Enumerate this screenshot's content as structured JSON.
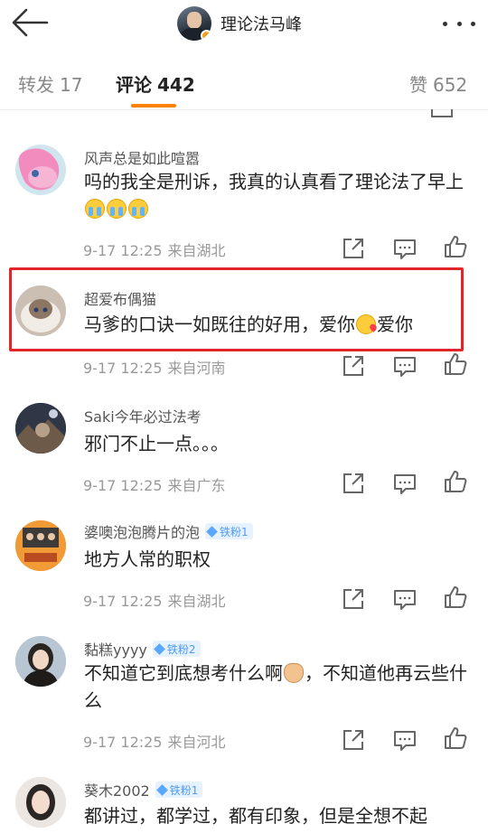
{
  "header": {
    "title": "理论法马峰"
  },
  "tabs": [
    {
      "label": "转发",
      "count": "17"
    },
    {
      "label": "评论",
      "count": "442"
    },
    {
      "label": "赞",
      "count": "652"
    }
  ],
  "comments": [
    {
      "name": "风声总是如此喧嚣",
      "text": "吗的我全是刑诉，我真的认真看了理论法了早上",
      "emojis": [
        "crying",
        "crying",
        "crying"
      ],
      "time": "9-17 12:25",
      "location": "来自湖北"
    },
    {
      "name": "超爱布偶猫",
      "text_before": "马爹的口诀一如既往的好用，爱你",
      "text_after": "爱你",
      "emoji": "kiss",
      "time": "9-17 12:25",
      "location": "来自河南"
    },
    {
      "name": "Saki今年必过法考",
      "text": "邪门不止一点。。。",
      "time": "9-17 12:25",
      "location": "来自广东"
    },
    {
      "name": "婆噢泡泡腾片的泡",
      "badge": "铁粉1",
      "text": "地方人常的职权",
      "time": "9-17 12:25",
      "location": "来自湖北"
    },
    {
      "name": "黏糕yyyy",
      "badge": "铁粉2",
      "text_before": "不知道它到底想考什么啊",
      "text_after": "，不知道他再云些什么",
      "emoji": "cat",
      "time": "9-17 12:25",
      "location": "来自河北"
    },
    {
      "name": "葵木2002",
      "badge": "铁粉1",
      "text": "都讲过，都学过，都有印象，但是全想不起"
    }
  ],
  "icons": {
    "back": "back-arrow-icon",
    "more": "more-dots-icon",
    "share": "share-icon",
    "comment": "comment-icon",
    "like": "like-icon"
  },
  "colors": {
    "accent": "#ff8200",
    "highlight": "#e0262b",
    "badge": "#4e9bf4"
  }
}
